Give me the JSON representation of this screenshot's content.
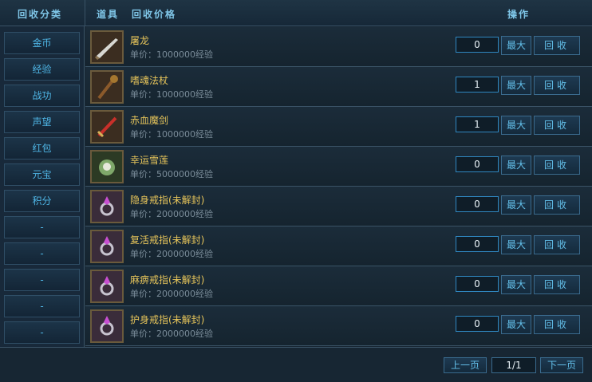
{
  "header": {
    "category_title": "回收分类",
    "col_item": "道具",
    "col_price": "回收价格",
    "col_action": "操作"
  },
  "categories": [
    "金币",
    "经验",
    "战功",
    "声望",
    "红包",
    "元宝",
    "积分",
    "-",
    "-",
    "-",
    "-",
    "-"
  ],
  "items": [
    {
      "name": "屠龙",
      "price": "单价：1000000经验",
      "qty": "0",
      "icon": "blade-icon"
    },
    {
      "name": "嗜魂法杖",
      "price": "单价：1000000经验",
      "qty": "1",
      "icon": "staff-icon"
    },
    {
      "name": "赤血魔剑",
      "price": "单价：1000000经验",
      "qty": "1",
      "icon": "red-sword-icon"
    },
    {
      "name": "幸运雪莲",
      "price": "单价：5000000经验",
      "qty": "0",
      "icon": "lotus-icon"
    },
    {
      "name": "隐身戒指(未解封)",
      "price": "单价：2000000经验",
      "qty": "0",
      "icon": "ring-icon"
    },
    {
      "name": "复活戒指(未解封)",
      "price": "单价：2000000经验",
      "qty": "0",
      "icon": "ring-icon"
    },
    {
      "name": "麻痹戒指(未解封)",
      "price": "单价：2000000经验",
      "qty": "0",
      "icon": "ring-icon"
    },
    {
      "name": "护身戒指(未解封)",
      "price": "单价：2000000经验",
      "qty": "0",
      "icon": "ring-icon"
    }
  ],
  "buttons": {
    "max": "最大",
    "recycle": "回收"
  },
  "pagination": {
    "prev": "上一页",
    "page": "1/1",
    "next": "下一页"
  }
}
